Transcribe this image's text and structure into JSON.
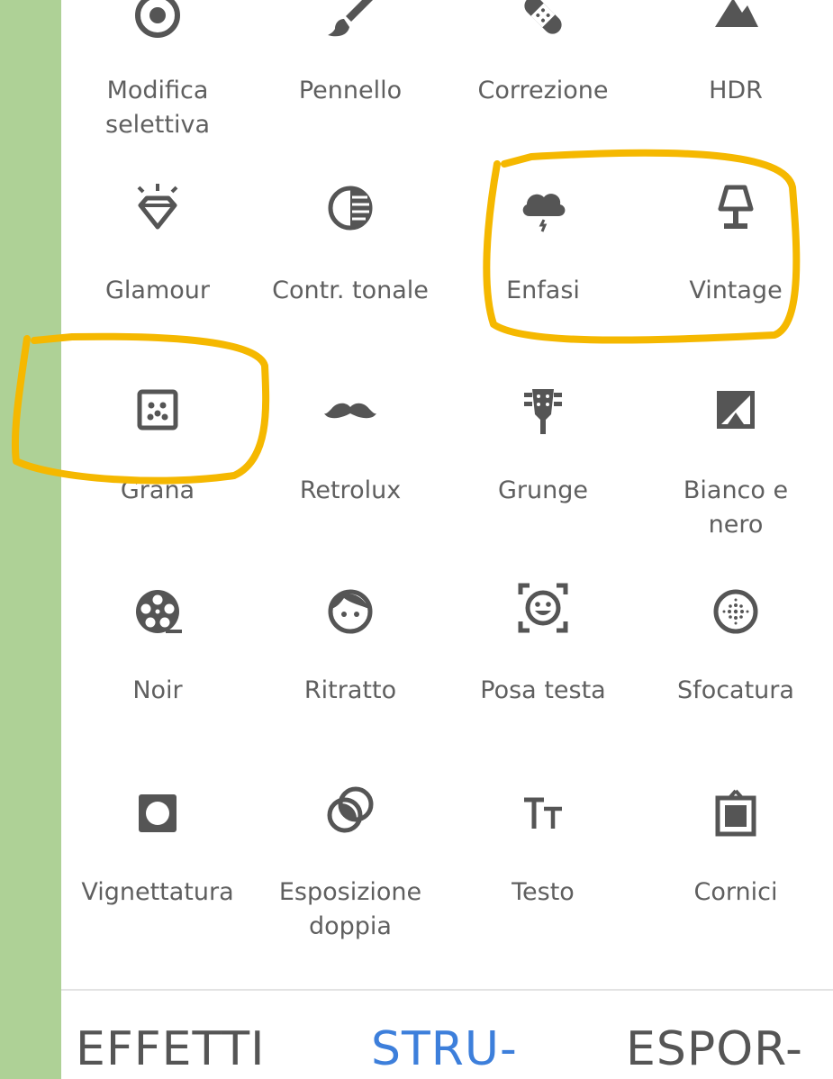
{
  "tools": [
    {
      "label": "Modifica\nselettiva",
      "icon": "target-icon"
    },
    {
      "label": "Pennello",
      "icon": "brush-icon"
    },
    {
      "label": "Correzione",
      "icon": "bandage-icon"
    },
    {
      "label": "HDR",
      "icon": "mountain-icon"
    },
    {
      "label": "Glamour",
      "icon": "diamond-icon"
    },
    {
      "label": "Contr. tonale",
      "icon": "tonal-contrast-icon"
    },
    {
      "label": "Enfasi",
      "icon": "storm-cloud-icon"
    },
    {
      "label": "Vintage",
      "icon": "lamp-icon"
    },
    {
      "label": "Grana",
      "icon": "grain-dots-icon"
    },
    {
      "label": "Retrolux",
      "icon": "mustache-icon"
    },
    {
      "label": "Grunge",
      "icon": "guitar-head-icon"
    },
    {
      "label": "Bianco e\nnero",
      "icon": "black-white-icon"
    },
    {
      "label": "Noir",
      "icon": "film-reel-icon"
    },
    {
      "label": "Ritratto",
      "icon": "portrait-face-icon"
    },
    {
      "label": "Posa testa",
      "icon": "face-pose-icon"
    },
    {
      "label": "Sfocatura",
      "icon": "lens-blur-icon"
    },
    {
      "label": "Vignettatura",
      "icon": "vignette-icon"
    },
    {
      "label": "Esposizione\ndoppia",
      "icon": "double-exposure-icon"
    },
    {
      "label": "Testo",
      "icon": "text-icon"
    },
    {
      "label": "Cornici",
      "icon": "frame-icon"
    }
  ],
  "bottom_nav": {
    "effects_label": "EFFETTI",
    "tools_label": "STRU-",
    "export_label": "ESPOR-"
  },
  "colors": {
    "background": "#aed196",
    "icon": "#555555",
    "label": "#5f5f5f",
    "active_tab": "#3d7fdb",
    "highlight": "#f5b800"
  }
}
